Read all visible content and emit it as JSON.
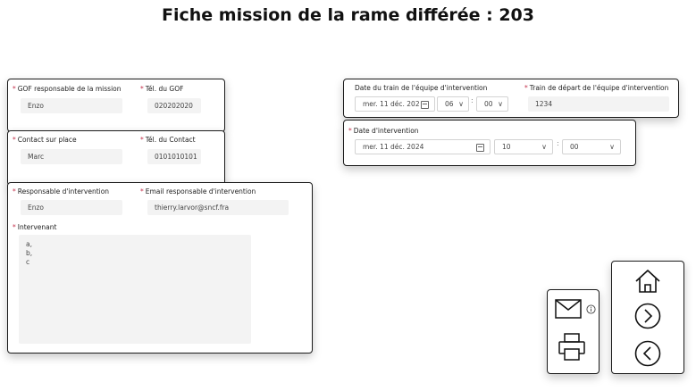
{
  "title": "Fiche mission de la rame différée : 203",
  "mission": {
    "gof_label": "GOF responsable de la mission",
    "gof_value": "Enzo",
    "tel_gof_label": "Tél. du GOF",
    "tel_gof_value": "020202020",
    "contact_label": "Contact sur place",
    "contact_value": "Marc",
    "tel_contact_label": "Tél. du Contact",
    "tel_contact_value": "0101010101"
  },
  "intervention": {
    "resp_label": "Responsable d'intervention",
    "resp_value": "Enzo",
    "email_label": "Email responsable d'intervention",
    "email_value": "thierry.larvor@sncf.fra",
    "intervenant_label": "Intervenant",
    "intervenant_value": "a,\nb,\nc"
  },
  "train": {
    "date_label": "Date du train de l'équipe d'intervention",
    "date_value": "mer. 11 déc. 202",
    "hour_value": "06",
    "minute_value": "00",
    "depart_label": "Train de départ de l'équipe d'intervention",
    "depart_value": "1234"
  },
  "date_intervention": {
    "label": "Date d'intervention",
    "date_value": "mer. 11 déc. 2024",
    "hour_value": "10",
    "minute_value": "00"
  },
  "icons": {
    "mail": "mail-icon",
    "info": "info-icon",
    "print": "printer-icon",
    "home": "home-icon",
    "next": "chevron-right-circle-icon",
    "prev": "chevron-left-circle-icon"
  },
  "colors": {
    "required": "#c4314b",
    "border": "#1b1b1b",
    "field_bg": "#f3f3f3"
  }
}
